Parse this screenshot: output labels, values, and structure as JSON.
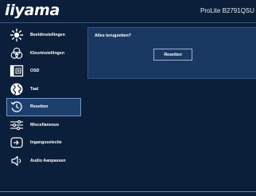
{
  "header": {
    "brand": "iiyama",
    "model": "ProLite B2791QSU"
  },
  "sidebar": {
    "items": [
      {
        "label": "Beeldinstellingen",
        "icon": "picture-settings-icon",
        "active": false
      },
      {
        "label": "Kleurinstellingen",
        "icon": "color-settings-icon",
        "active": false
      },
      {
        "label": "OSD",
        "icon": "osd-icon",
        "active": false
      },
      {
        "label": "Taal",
        "icon": "globe-icon",
        "active": false
      },
      {
        "label": "Resetten",
        "icon": "reset-icon",
        "active": true
      },
      {
        "label": "Miscellaneous",
        "icon": "sliders-icon",
        "active": false
      },
      {
        "label": "Ingangsselectie",
        "icon": "input-select-icon",
        "active": false
      },
      {
        "label": "Audio Aanpassen",
        "icon": "speaker-icon",
        "active": false
      }
    ]
  },
  "content": {
    "question": "Alles terugzetten?",
    "button_label": "Resetten"
  },
  "colors": {
    "background": "#0b1f3a",
    "panel": "#1a3962",
    "active_item": "#1c3f6d",
    "border": "#6f95c7"
  }
}
